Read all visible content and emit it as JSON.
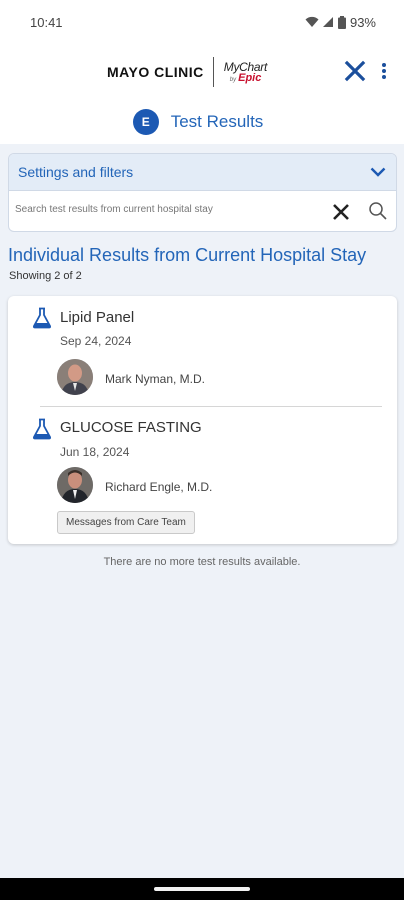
{
  "status_bar": {
    "time": "10:41",
    "battery": "93%",
    "icons": [
      "wifi-icon",
      "signal-icon",
      "battery-icon"
    ]
  },
  "header": {
    "brand_name": "MAYO CLINIC",
    "partner_name": "MyChart",
    "partner_by": "by",
    "partner_vendor": "Epic",
    "close_icon": "close-icon",
    "menu_icon": "more-vert-icon"
  },
  "patient": {
    "initial": "E",
    "page_title": "Test Results"
  },
  "filters": {
    "label": "Settings and filters",
    "search_placeholder": "Search test results from current hospital stay",
    "search_value": ""
  },
  "results": {
    "title": "Individual Results from Current Hospital Stay",
    "count": "Showing 2 of 2",
    "items": [
      {
        "name": "Lipid Panel",
        "date": "Sep 24, 2024",
        "provider": "Mark Nyman, M.D.",
        "icon": "flask-icon"
      },
      {
        "name": "GLUCOSE FASTING",
        "date": "Jun 18, 2024",
        "provider": "Richard Engle, M.D.",
        "icon": "flask-icon"
      }
    ],
    "message_button": "Messages from Care Team",
    "no_more": "There are no more test results available."
  },
  "colors": {
    "accent": "#2365b8",
    "brand_blue": "#1c59b3",
    "epic_red": "#c8102e",
    "background": "#eef2f8"
  }
}
